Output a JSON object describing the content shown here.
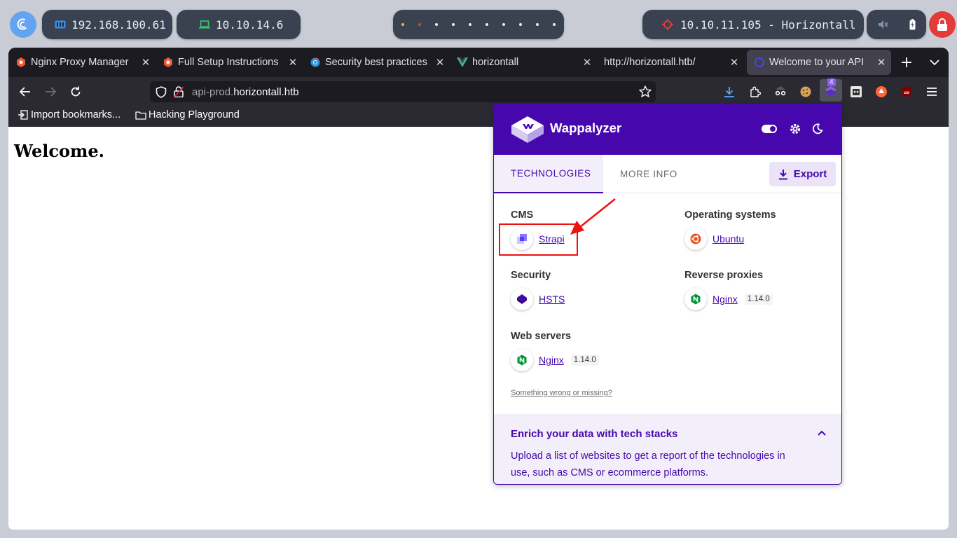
{
  "desktop": {
    "ip_local": "192.168.100.61",
    "ip_vpn": "10.10.14.6",
    "target": "10.10.11.105 - Horizontall",
    "accent_color": "#63a4f0",
    "lock_color": "#e33a3a"
  },
  "browser": {
    "tabs": [
      {
        "title": "Nginx Proxy Manager",
        "icon": "nginx-proxy-icon"
      },
      {
        "title": "Full Setup Instructions",
        "icon": "nginx-proxy-icon"
      },
      {
        "title": "Security best practices",
        "icon": "chrome-icon"
      },
      {
        "title": "horizontall",
        "icon": "vue-icon"
      },
      {
        "title": "http://horizontall.htb/",
        "icon": ""
      },
      {
        "title": "Welcome to your API",
        "icon": "strapi-icon",
        "active": true
      }
    ],
    "url": {
      "subdomain": "api-prod.",
      "domain": "horizontall.htb"
    },
    "extension_badge": "4",
    "bookmarks": [
      {
        "label": "Import bookmarks...",
        "icon": "import-icon"
      },
      {
        "label": "Hacking Playground",
        "icon": "folder-icon"
      }
    ]
  },
  "page": {
    "heading": "Welcome."
  },
  "wappalyzer": {
    "brand": "Wappalyzer",
    "tabs": [
      "TECHNOLOGIES",
      "MORE INFO"
    ],
    "export_label": "Export",
    "categories": [
      {
        "name": "CMS",
        "techs": [
          {
            "name": "Strapi",
            "version": ""
          }
        ]
      },
      {
        "name": "Operating systems",
        "techs": [
          {
            "name": "Ubuntu",
            "version": ""
          }
        ]
      },
      {
        "name": "Security",
        "techs": [
          {
            "name": "HSTS",
            "version": ""
          }
        ]
      },
      {
        "name": "Reverse proxies",
        "techs": [
          {
            "name": "Nginx",
            "version": "1.14.0"
          }
        ]
      },
      {
        "name": "Web servers",
        "techs": [
          {
            "name": "Nginx",
            "version": "1.14.0"
          }
        ]
      }
    ],
    "missing_link": "Something wrong or missing?",
    "enrich": {
      "title": "Enrich your data with tech stacks",
      "text": "Upload a list of websites to get a report of the technologies in use, such as CMS or ecommerce platforms."
    },
    "brand_color": "#4608ad"
  }
}
